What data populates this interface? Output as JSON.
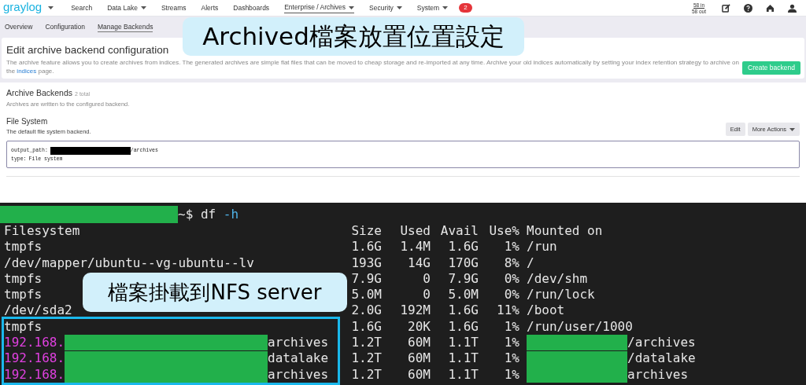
{
  "nav": {
    "logo": "graylog",
    "items": [
      {
        "label": "Search",
        "dropdown": false,
        "selected": false
      },
      {
        "label": "Data Lake",
        "dropdown": true,
        "selected": false
      },
      {
        "label": "Streams",
        "dropdown": false,
        "selected": false
      },
      {
        "label": "Alerts",
        "dropdown": false,
        "selected": false
      },
      {
        "label": "Dashboards",
        "dropdown": false,
        "selected": false
      },
      {
        "label": "Enterprise / Archives",
        "dropdown": true,
        "selected": true
      },
      {
        "label": "Security",
        "dropdown": true,
        "selected": false
      },
      {
        "label": "System",
        "dropdown": true,
        "selected": false
      }
    ],
    "badge": "2",
    "throughput_in": "58 in",
    "throughput_out": "58 out"
  },
  "subnav": [
    {
      "label": "Overview",
      "selected": false
    },
    {
      "label": "Configuration",
      "selected": false
    },
    {
      "label": "Manage Backends",
      "selected": true
    }
  ],
  "header": {
    "title": "Edit archive backend configuration",
    "description": "The archive feature allows you to create archives from indices. The generated archives are simple flat files that can be moved to cheap storage and re-imported at any time. Archive your old indices automatically by setting your index retention strategy to archive on the",
    "link": "indices",
    "description_end": "page.",
    "button": "Create backend"
  },
  "backends": {
    "title": "Archive Backends",
    "count": "2 total",
    "description": "Archives are written to the configured backend.",
    "backend": {
      "name": "File System",
      "description": "The default file system backend.",
      "edit": "Edit",
      "more": "More Actions",
      "config": [
        {
          "key": "output_path:",
          "redacted": true,
          "value": "/archives"
        },
        {
          "key": "type:",
          "redacted": false,
          "value": "File system"
        }
      ]
    }
  },
  "terminal": {
    "prompt": "~$",
    "command": "df",
    "argument": "-h",
    "header": [
      "Filesystem",
      "Size",
      "Used",
      "Avail",
      "Use%",
      "Mounted on"
    ],
    "rows": [
      {
        "kind": "local",
        "filesystem": "tmpfs",
        "size": "1.6G",
        "used": "1.4M",
        "avail": "1.6G",
        "use": "1%",
        "mounted": "/run",
        "highlighted": false
      },
      {
        "kind": "local",
        "filesystem": "/dev/mapper/ubuntu--vg-ubuntu--lv",
        "size": "193G",
        "used": "14G",
        "avail": "170G",
        "use": "8%",
        "mounted": "/",
        "highlighted": false
      },
      {
        "kind": "local",
        "filesystem": "tmpfs",
        "size": "7.9G",
        "used": "0",
        "avail": "7.9G",
        "use": "0%",
        "mounted": "/dev/shm",
        "highlighted": false
      },
      {
        "kind": "local",
        "filesystem": "tmpfs",
        "size": "5.0M",
        "used": "0",
        "avail": "5.0M",
        "use": "0%",
        "mounted": "/run/lock",
        "highlighted": false
      },
      {
        "kind": "local",
        "filesystem": "/dev/sda2",
        "size": "2.0G",
        "used": "192M",
        "avail": "1.6G",
        "use": "11%",
        "mounted": "/boot",
        "highlighted": false
      },
      {
        "kind": "local",
        "filesystem": "tmpfs",
        "size": "1.6G",
        "used": "20K",
        "avail": "1.6G",
        "use": "1%",
        "mounted": "/run/user/1000",
        "highlighted": true
      },
      {
        "kind": "nfs",
        "filesystem": "192.168.",
        "filesystem_end": "archives",
        "size": "1.2T",
        "used": "60M",
        "avail": "1.1T",
        "use": "1%",
        "mounted": "/archives",
        "highlighted": true
      },
      {
        "kind": "nfs",
        "filesystem": "192.168.",
        "filesystem_end": "datalake",
        "size": "1.2T",
        "used": "60M",
        "avail": "1.1T",
        "use": "1%",
        "mounted": "/datalake",
        "highlighted": true
      },
      {
        "kind": "nfs",
        "filesystem": "192.168.",
        "filesystem_end": "archives",
        "size": "1.2T",
        "used": "60M",
        "avail": "1.1T",
        "use": "1%",
        "mounted": "archives",
        "highlighted": true
      }
    ]
  },
  "annotations": [
    "Archived檔案放置位置設定",
    "檔案掛載到NFS server"
  ]
}
